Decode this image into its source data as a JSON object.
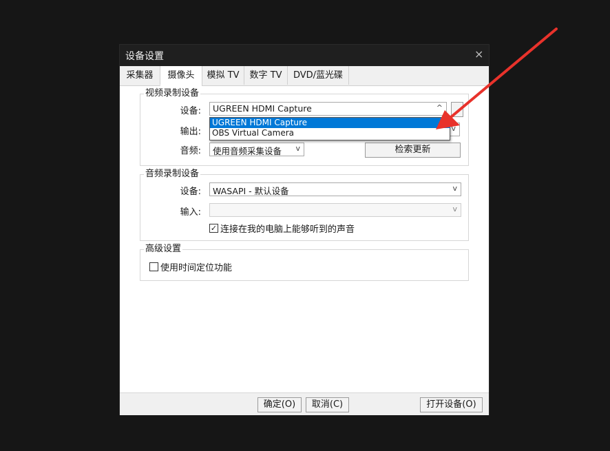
{
  "dialog": {
    "title": "设备设置",
    "close_label": "×"
  },
  "tabs": [
    "采集器",
    "摄像头",
    "模拟 TV",
    "数字 TV",
    "DVD/蓝光碟"
  ],
  "video_group": {
    "legend": "视频录制设备",
    "device_label": "设备:",
    "device_value": "UGREEN HDMI Capture",
    "device_arrow": "^",
    "output_label": "输出:",
    "audio_label": "音频:",
    "audio_value": "使用音频采集设备",
    "refresh_button": "检索更新",
    "dropdown_options": [
      "UGREEN HDMI Capture",
      "OBS Virtual Camera"
    ]
  },
  "audio_group": {
    "legend": "音频录制设备",
    "device_label": "设备:",
    "device_value": "WASAPI - 默认设备",
    "input_label": "输入:",
    "input_value": "",
    "listen_checkbox_label": "连接在我的电脑上能够听到的声音",
    "listen_checked": true
  },
  "advanced_group": {
    "legend": "高级设置",
    "timeshift_label": "使用时间定位功能",
    "timeshift_checked": false
  },
  "footer": {
    "ok": "确定(O)",
    "cancel": "取消(C)",
    "open_device": "打开设备(O)"
  },
  "glyphs": {
    "down_arrow": "v",
    "check": "✓"
  },
  "colors": {
    "annotation_arrow": "#e8322b",
    "selection": "#0078d7"
  }
}
